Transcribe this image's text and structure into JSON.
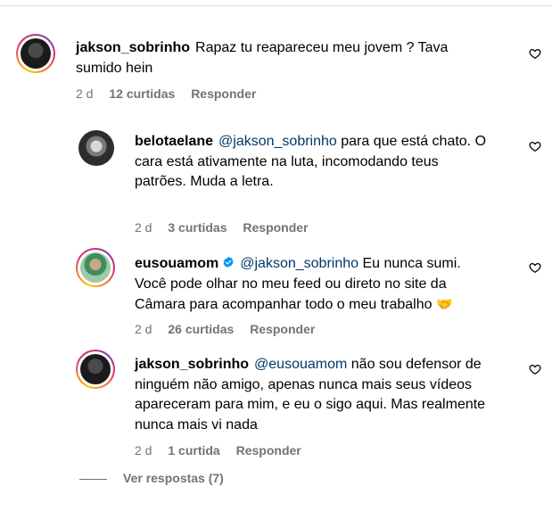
{
  "comments": [
    {
      "username": "jakson_sobrinho",
      "mention": "",
      "text": "Rapaz tu reapareceu meu jovem ? Tava sumido hein",
      "time": "2 d",
      "likes": "12 curtidas",
      "reply": "Responder"
    },
    {
      "username": "belotaelane",
      "mention": "@jakson_sobrinho",
      "text": " para que está chato. O cara está ativamente na luta, incomodando teus patrões. Muda a letra.",
      "time": "2 d",
      "likes": "3 curtidas",
      "reply": "Responder"
    },
    {
      "username": "eusouamom",
      "verified": true,
      "mention": "@jakson_sobrinho",
      "text": " Eu nunca sumi. Você pode olhar no meu feed ou direto no site da Câmara para acompanhar todo o meu trabalho ",
      "emoji": "🤝",
      "time": "2 d",
      "likes": "26 curtidas",
      "reply": "Responder"
    },
    {
      "username": "jakson_sobrinho",
      "mention": "@eusouamom",
      "text": " não sou defensor de ninguém não amigo, apenas nunca mais seus vídeos apareceram para mim, e eu o sigo aqui. Mas realmente nunca mais vi nada",
      "time": "2 d",
      "likes": "1 curtida",
      "reply": "Responder"
    }
  ],
  "view_replies": "Ver respostas (7)",
  "icons": {
    "like": "heart-outline-icon",
    "verified": "verified-badge-icon"
  },
  "colors": {
    "mention": "#00376b",
    "meta": "#737373",
    "verified": "#0095f6"
  }
}
